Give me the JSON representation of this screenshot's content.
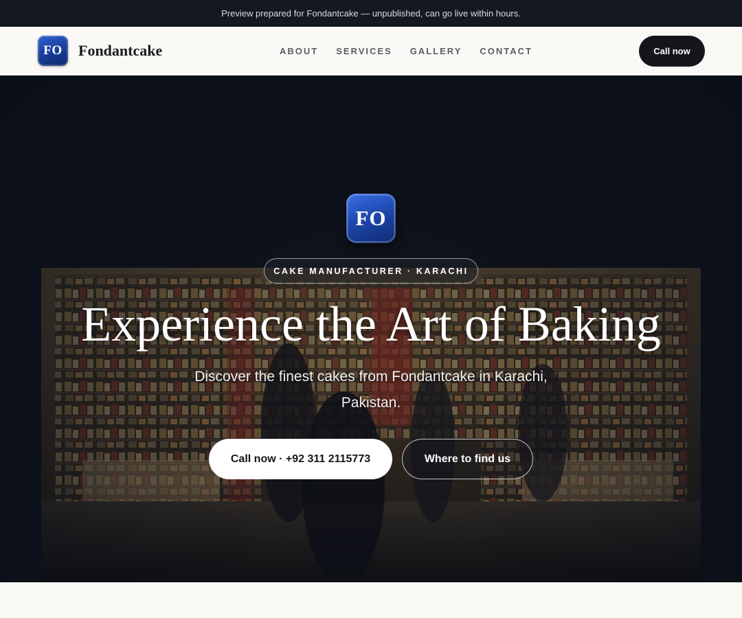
{
  "preview_banner": {
    "text": "Preview prepared for Fondantcake — unpublished, can go live within hours."
  },
  "header": {
    "logo_initials": "FO",
    "brand_name": "Fondantcake",
    "nav": [
      {
        "label": "ABOUT"
      },
      {
        "label": "SERVICES"
      },
      {
        "label": "GALLERY"
      },
      {
        "label": "CONTACT"
      }
    ],
    "cta_label": "Call now"
  },
  "hero": {
    "logo_initials": "FO",
    "badge": "CAKE MANUFACTURER · KARACHI",
    "title": "Experience the Art of Baking",
    "subtitle": "Discover the finest cakes from Fondantcake in Karachi, Pakistan.",
    "primary_button": "Call now · +92 311 2115773",
    "secondary_button": "Where to find us",
    "background_image": "bakery-shop-interior-photo"
  },
  "colors": {
    "preview_bar_bg": "#141820",
    "nav_bg": "#faf9f6",
    "accent_dark": "#15161c",
    "logo_blue": "#1a3f9b"
  }
}
